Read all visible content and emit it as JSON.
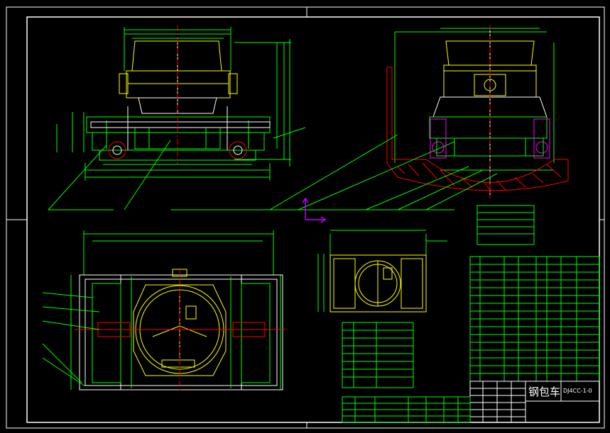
{
  "title_block": {
    "part_name": "钢包车",
    "drawing_number": "DJ4CC-1-0"
  },
  "colors": {
    "background": "#000000",
    "frame": "#ffffff",
    "outline": "#00ff00",
    "body": "#ffff00",
    "hatch": "#ff0000",
    "wheel": "#ff00ff",
    "centerline": "#ff0000",
    "dimension": "#00ff00",
    "axis": "#c000ff"
  },
  "views": {
    "front": "front-elevation",
    "side": "side-elevation",
    "plan": "plan-view",
    "detail": "detail-view"
  }
}
